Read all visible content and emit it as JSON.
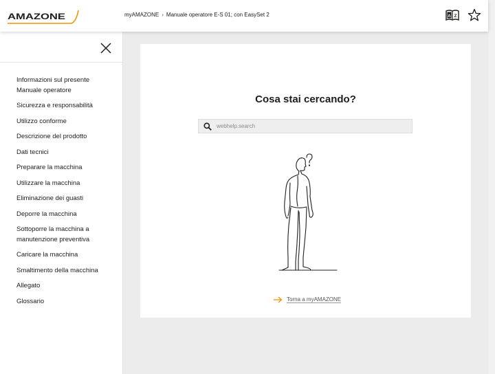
{
  "header": {
    "brand": "AMAZONE",
    "breadcrumb": [
      {
        "label": "myAMAZONE"
      },
      {
        "label": "Manuale operatore E-S 01; con EasySet 2"
      }
    ],
    "icons": [
      "dictionary-icon",
      "star-icon"
    ]
  },
  "sidebar": {
    "close_icon": "close-icon",
    "items": [
      {
        "label": "Informazioni sul presente Manuale operatore"
      },
      {
        "label": "Sicurezza e responsabilità"
      },
      {
        "label": "Utilizzo conforme"
      },
      {
        "label": "Descrizione del prodotto"
      },
      {
        "label": "Dati tecnici"
      },
      {
        "label": "Preparare la macchina"
      },
      {
        "label": "Utilizzare la macchina"
      },
      {
        "label": "Eliminazione dei guasti"
      },
      {
        "label": "Deporre la macchina"
      },
      {
        "label": "Sottoporre la macchina a manutenzione preventiva"
      },
      {
        "label": "Caricare la macchina"
      },
      {
        "label": "Smaltimento della macchina"
      },
      {
        "label": "Allegato"
      },
      {
        "label": "Glossario"
      }
    ]
  },
  "main": {
    "title": "Cosa stai cercando?",
    "search": {
      "placeholder": "webhelp.search",
      "value": ""
    },
    "back_link": "Torna a myAMAZONE"
  },
  "colors": {
    "brand_orange": "#f39200",
    "text": "#1d1d1b",
    "panel_bg": "#ececec"
  }
}
